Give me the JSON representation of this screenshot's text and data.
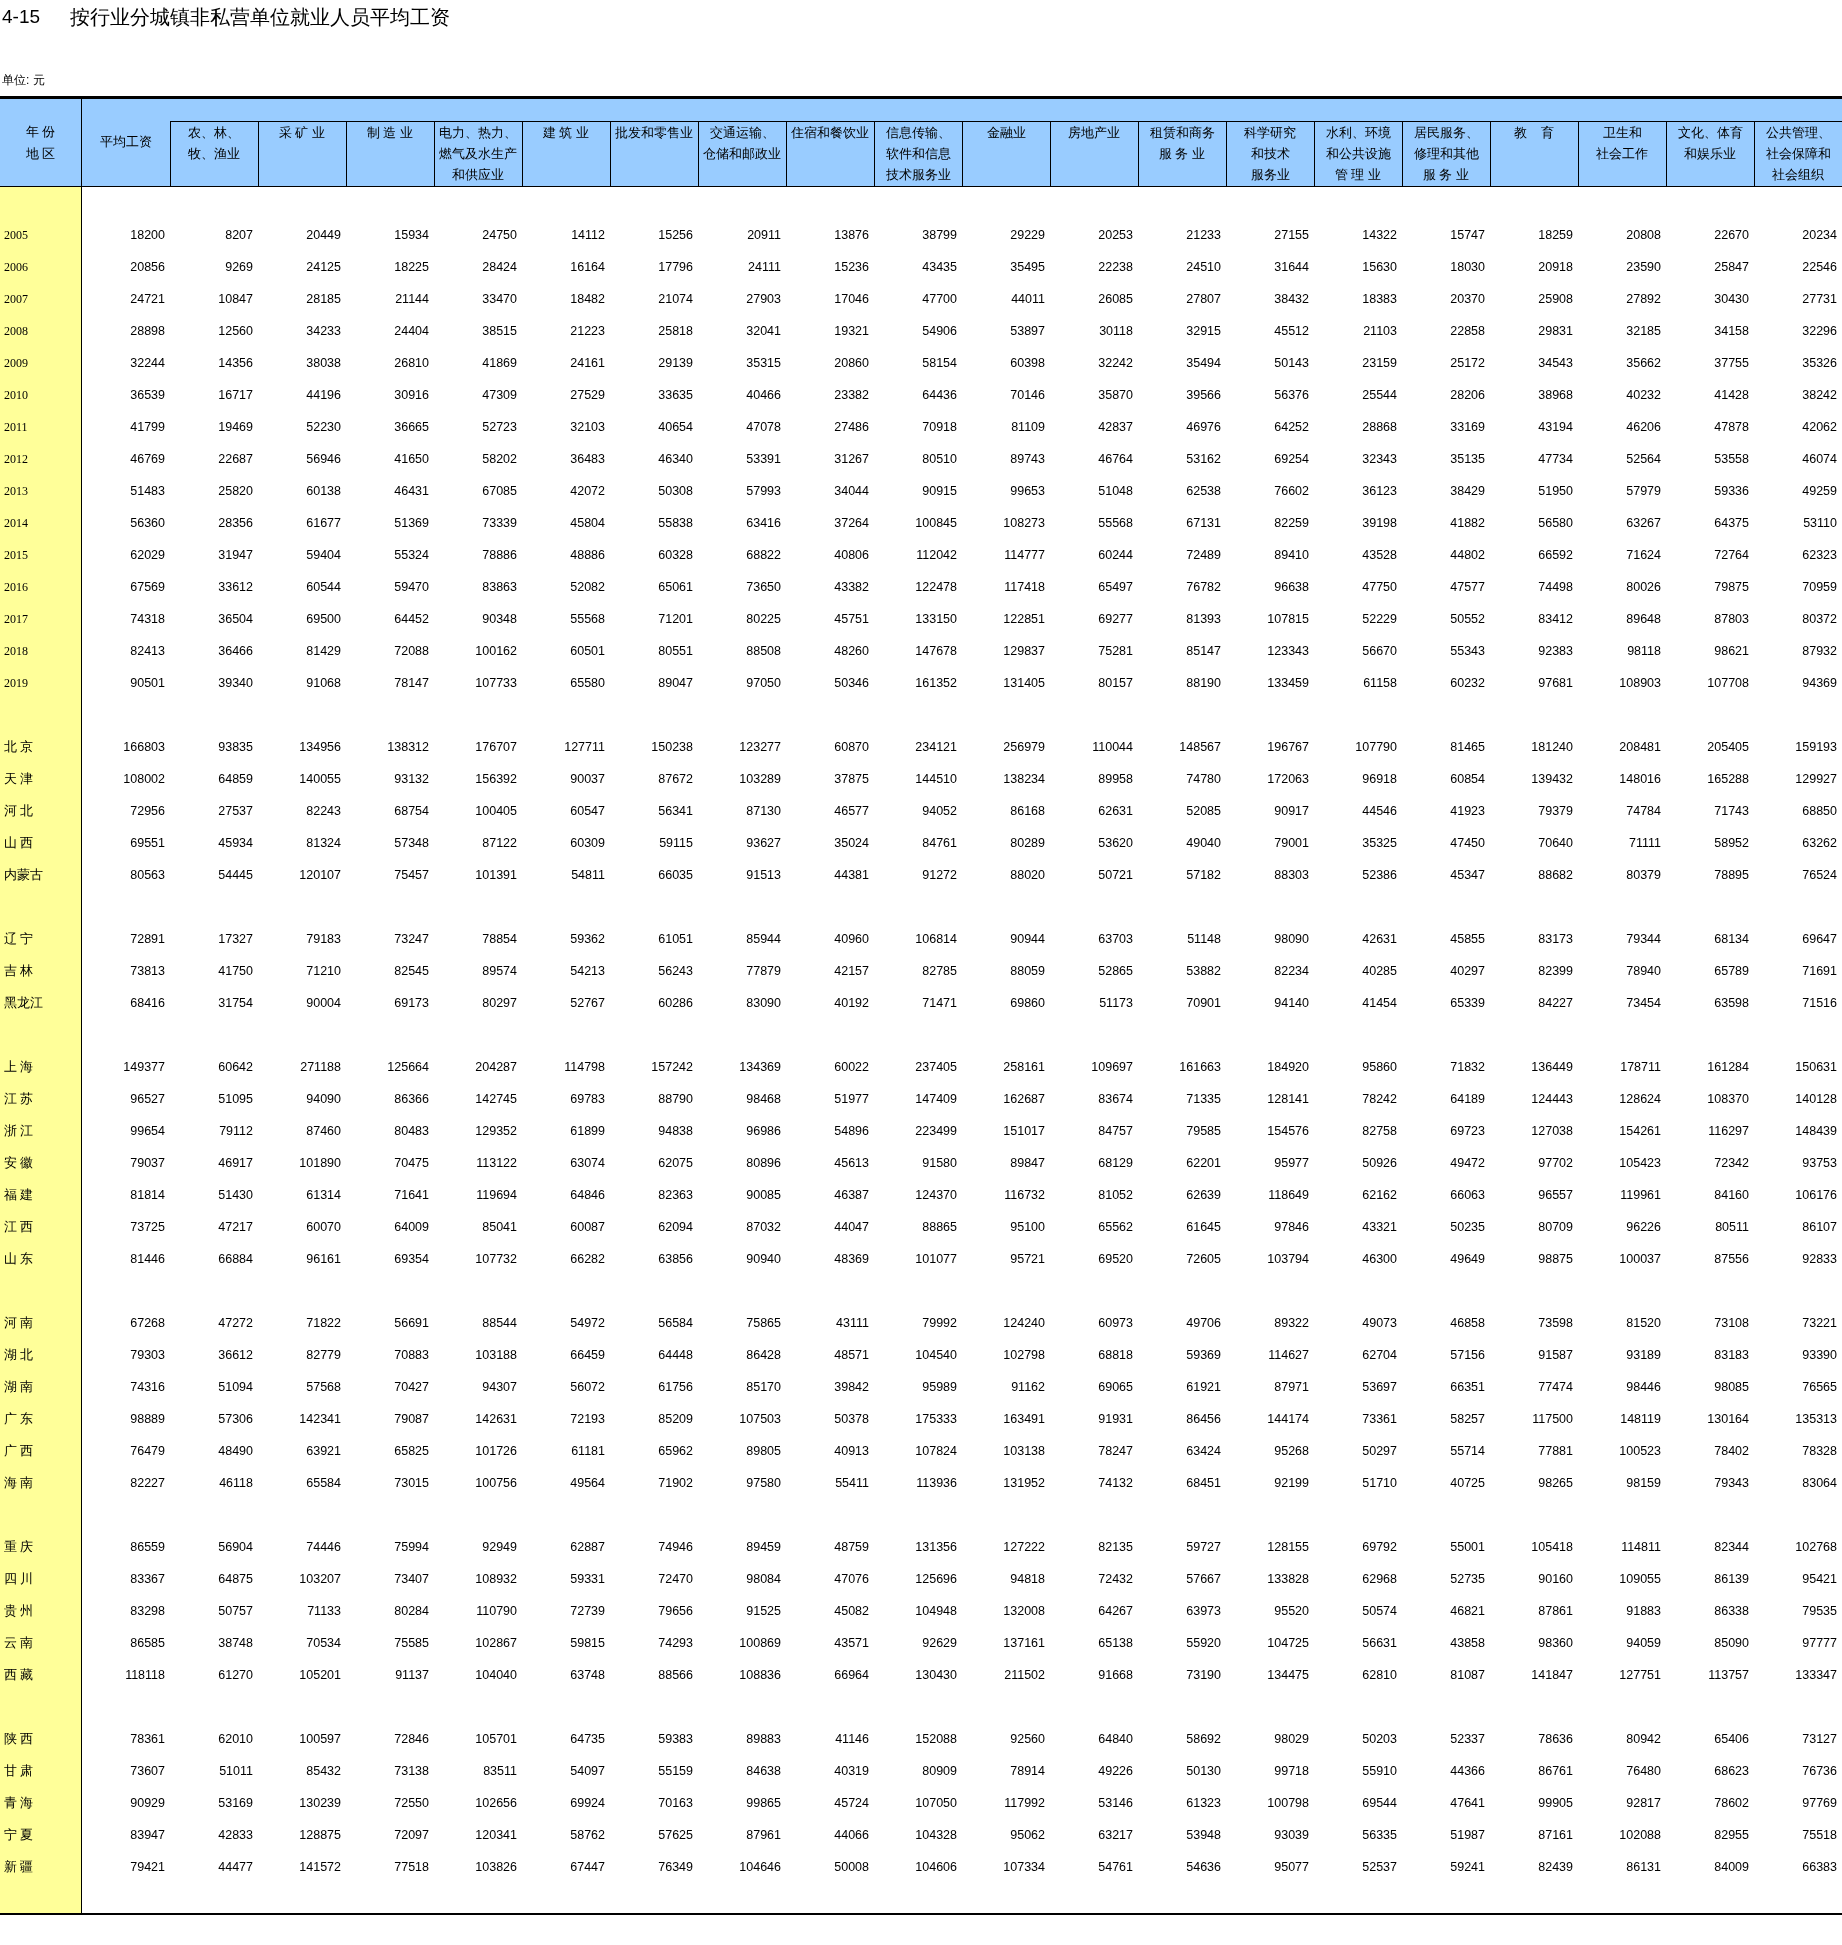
{
  "table_number": "4-15",
  "title": "按行业分城镇非私营单位就业人员平均工资",
  "unit": "单位: 元",
  "corner": [
    "年 份",
    "地 区"
  ],
  "columns": [
    [
      "平均工资"
    ],
    [
      "农、林、",
      "牧、渔业"
    ],
    [
      "采 矿 业"
    ],
    [
      "制 造 业"
    ],
    [
      "电力、热力、",
      "燃气及水生产",
      "和供应业"
    ],
    [
      "建 筑 业"
    ],
    [
      "批发和零售业"
    ],
    [
      "交通运输、",
      "仓储和邮政业"
    ],
    [
      "住宿和餐饮业"
    ],
    [
      "信息传输、",
      "软件和信息",
      "技术服务业"
    ],
    [
      "金融业"
    ],
    [
      "房地产业"
    ],
    [
      "租赁和商务",
      "服 务 业"
    ],
    [
      "科学研究",
      "和技术",
      "服务业"
    ],
    [
      "水利、环境",
      "和公共设施",
      "管 理 业"
    ],
    [
      "居民服务、",
      "修理和其他",
      "服 务 业"
    ],
    [
      "教    育"
    ],
    [
      "卫生和",
      "社会工作"
    ],
    [
      "文化、体育",
      "和娱乐业"
    ],
    [
      "公共管理、",
      "社会保障和",
      "社会组织"
    ]
  ],
  "sections": [
    {
      "kind": "year",
      "rows": [
        {
          "label": "2005",
          "values": [
            "18200",
            "8207",
            "20449",
            "15934",
            "24750",
            "14112",
            "15256",
            "20911",
            "13876",
            "38799",
            "29229",
            "20253",
            "21233",
            "27155",
            "14322",
            "15747",
            "18259",
            "20808",
            "22670",
            "20234"
          ]
        },
        {
          "label": "2006",
          "values": [
            "20856",
            "9269",
            "24125",
            "18225",
            "28424",
            "16164",
            "17796",
            "24111",
            "15236",
            "43435",
            "35495",
            "22238",
            "24510",
            "31644",
            "15630",
            "18030",
            "20918",
            "23590",
            "25847",
            "22546"
          ]
        },
        {
          "label": "2007",
          "values": [
            "24721",
            "10847",
            "28185",
            "21144",
            "33470",
            "18482",
            "21074",
            "27903",
            "17046",
            "47700",
            "44011",
            "26085",
            "27807",
            "38432",
            "18383",
            "20370",
            "25908",
            "27892",
            "30430",
            "27731"
          ]
        },
        {
          "label": "2008",
          "values": [
            "28898",
            "12560",
            "34233",
            "24404",
            "38515",
            "21223",
            "25818",
            "32041",
            "19321",
            "54906",
            "53897",
            "30118",
            "32915",
            "45512",
            "21103",
            "22858",
            "29831",
            "32185",
            "34158",
            "32296"
          ]
        },
        {
          "label": "2009",
          "values": [
            "32244",
            "14356",
            "38038",
            "26810",
            "41869",
            "24161",
            "29139",
            "35315",
            "20860",
            "58154",
            "60398",
            "32242",
            "35494",
            "50143",
            "23159",
            "25172",
            "34543",
            "35662",
            "37755",
            "35326"
          ]
        },
        {
          "label": "2010",
          "values": [
            "36539",
            "16717",
            "44196",
            "30916",
            "47309",
            "27529",
            "33635",
            "40466",
            "23382",
            "64436",
            "70146",
            "35870",
            "39566",
            "56376",
            "25544",
            "28206",
            "38968",
            "40232",
            "41428",
            "38242"
          ]
        },
        {
          "label": "2011",
          "values": [
            "41799",
            "19469",
            "52230",
            "36665",
            "52723",
            "32103",
            "40654",
            "47078",
            "27486",
            "70918",
            "81109",
            "42837",
            "46976",
            "64252",
            "28868",
            "33169",
            "43194",
            "46206",
            "47878",
            "42062"
          ]
        },
        {
          "label": "2012",
          "values": [
            "46769",
            "22687",
            "56946",
            "41650",
            "58202",
            "36483",
            "46340",
            "53391",
            "31267",
            "80510",
            "89743",
            "46764",
            "53162",
            "69254",
            "32343",
            "35135",
            "47734",
            "52564",
            "53558",
            "46074"
          ]
        },
        {
          "label": "2013",
          "values": [
            "51483",
            "25820",
            "60138",
            "46431",
            "67085",
            "42072",
            "50308",
            "57993",
            "34044",
            "90915",
            "99653",
            "51048",
            "62538",
            "76602",
            "36123",
            "38429",
            "51950",
            "57979",
            "59336",
            "49259"
          ]
        },
        {
          "label": "2014",
          "values": [
            "56360",
            "28356",
            "61677",
            "51369",
            "73339",
            "45804",
            "55838",
            "63416",
            "37264",
            "100845",
            "108273",
            "55568",
            "67131",
            "82259",
            "39198",
            "41882",
            "56580",
            "63267",
            "64375",
            "53110"
          ]
        },
        {
          "label": "2015",
          "values": [
            "62029",
            "31947",
            "59404",
            "55324",
            "78886",
            "48886",
            "60328",
            "68822",
            "40806",
            "112042",
            "114777",
            "60244",
            "72489",
            "89410",
            "43528",
            "44802",
            "66592",
            "71624",
            "72764",
            "62323"
          ]
        },
        {
          "label": "2016",
          "values": [
            "67569",
            "33612",
            "60544",
            "59470",
            "83863",
            "52082",
            "65061",
            "73650",
            "43382",
            "122478",
            "117418",
            "65497",
            "76782",
            "96638",
            "47750",
            "47577",
            "74498",
            "80026",
            "79875",
            "70959"
          ]
        },
        {
          "label": "2017",
          "values": [
            "74318",
            "36504",
            "69500",
            "64452",
            "90348",
            "55568",
            "71201",
            "80225",
            "45751",
            "133150",
            "122851",
            "69277",
            "81393",
            "107815",
            "52229",
            "50552",
            "83412",
            "89648",
            "87803",
            "80372"
          ]
        },
        {
          "label": "2018",
          "values": [
            "82413",
            "36466",
            "81429",
            "72088",
            "100162",
            "60501",
            "80551",
            "88508",
            "48260",
            "147678",
            "129837",
            "75281",
            "85147",
            "123343",
            "56670",
            "55343",
            "92383",
            "98118",
            "98621",
            "87932"
          ]
        },
        {
          "label": "2019",
          "values": [
            "90501",
            "39340",
            "91068",
            "78147",
            "107733",
            "65580",
            "89047",
            "97050",
            "50346",
            "161352",
            "131405",
            "80157",
            "88190",
            "133459",
            "61158",
            "60232",
            "97681",
            "108903",
            "107708",
            "94369"
          ]
        }
      ]
    },
    {
      "kind": "region",
      "rows": [
        {
          "label": "北 京",
          "values": [
            "166803",
            "93835",
            "134956",
            "138312",
            "176707",
            "127711",
            "150238",
            "123277",
            "60870",
            "234121",
            "256979",
            "110044",
            "148567",
            "196767",
            "107790",
            "81465",
            "181240",
            "208481",
            "205405",
            "159193"
          ]
        },
        {
          "label": "天 津",
          "values": [
            "108002",
            "64859",
            "140055",
            "93132",
            "156392",
            "90037",
            "87672",
            "103289",
            "37875",
            "144510",
            "138234",
            "89958",
            "74780",
            "172063",
            "96918",
            "60854",
            "139432",
            "148016",
            "165288",
            "129927"
          ]
        },
        {
          "label": "河 北",
          "values": [
            "72956",
            "27537",
            "82243",
            "68754",
            "100405",
            "60547",
            "56341",
            "87130",
            "46577",
            "94052",
            "86168",
            "62631",
            "52085",
            "90917",
            "44546",
            "41923",
            "79379",
            "74784",
            "71743",
            "68850"
          ]
        },
        {
          "label": "山 西",
          "values": [
            "69551",
            "45934",
            "81324",
            "57348",
            "87122",
            "60309",
            "59115",
            "93627",
            "35024",
            "84761",
            "80289",
            "53620",
            "49040",
            "79001",
            "35325",
            "47450",
            "70640",
            "71111",
            "58952",
            "63262"
          ]
        },
        {
          "label": "内蒙古",
          "values": [
            "80563",
            "54445",
            "120107",
            "75457",
            "101391",
            "54811",
            "66035",
            "91513",
            "44381",
            "91272",
            "88020",
            "50721",
            "57182",
            "88303",
            "52386",
            "45347",
            "88682",
            "80379",
            "78895",
            "76524"
          ]
        }
      ]
    },
    {
      "kind": "region",
      "rows": [
        {
          "label": "辽 宁",
          "values": [
            "72891",
            "17327",
            "79183",
            "73247",
            "78854",
            "59362",
            "61051",
            "85944",
            "40960",
            "106814",
            "90944",
            "63703",
            "51148",
            "98090",
            "42631",
            "45855",
            "83173",
            "79344",
            "68134",
            "69647"
          ]
        },
        {
          "label": "吉 林",
          "values": [
            "73813",
            "41750",
            "71210",
            "82545",
            "89574",
            "54213",
            "56243",
            "77879",
            "42157",
            "82785",
            "88059",
            "52865",
            "53882",
            "82234",
            "40285",
            "40297",
            "82399",
            "78940",
            "65789",
            "71691"
          ]
        },
        {
          "label": "黑龙江",
          "values": [
            "68416",
            "31754",
            "90004",
            "69173",
            "80297",
            "52767",
            "60286",
            "83090",
            "40192",
            "71471",
            "69860",
            "51173",
            "70901",
            "94140",
            "41454",
            "65339",
            "84227",
            "73454",
            "63598",
            "71516"
          ]
        }
      ]
    },
    {
      "kind": "region",
      "rows": [
        {
          "label": "上 海",
          "values": [
            "149377",
            "60642",
            "271188",
            "125664",
            "204287",
            "114798",
            "157242",
            "134369",
            "60022",
            "237405",
            "258161",
            "109697",
            "161663",
            "184920",
            "95860",
            "71832",
            "136449",
            "178711",
            "161284",
            "150631"
          ]
        },
        {
          "label": "江 苏",
          "values": [
            "96527",
            "51095",
            "94090",
            "86366",
            "142745",
            "69783",
            "88790",
            "98468",
            "51977",
            "147409",
            "162687",
            "83674",
            "71335",
            "128141",
            "78242",
            "64189",
            "124443",
            "128624",
            "108370",
            "140128"
          ]
        },
        {
          "label": "浙 江",
          "values": [
            "99654",
            "79112",
            "87460",
            "80483",
            "129352",
            "61899",
            "94838",
            "96986",
            "54896",
            "223499",
            "151017",
            "84757",
            "79585",
            "154576",
            "82758",
            "69723",
            "127038",
            "154261",
            "116297",
            "148439"
          ]
        },
        {
          "label": "安 徽",
          "values": [
            "79037",
            "46917",
            "101890",
            "70475",
            "113122",
            "63074",
            "62075",
            "80896",
            "45613",
            "91580",
            "89847",
            "68129",
            "62201",
            "95977",
            "50926",
            "49472",
            "97702",
            "105423",
            "72342",
            "93753"
          ]
        },
        {
          "label": "福 建",
          "values": [
            "81814",
            "51430",
            "61314",
            "71641",
            "119694",
            "64846",
            "82363",
            "90085",
            "46387",
            "124370",
            "116732",
            "81052",
            "62639",
            "118649",
            "62162",
            "66063",
            "96557",
            "119961",
            "84160",
            "106176"
          ]
        },
        {
          "label": "江 西",
          "values": [
            "73725",
            "47217",
            "60070",
            "64009",
            "85041",
            "60087",
            "62094",
            "87032",
            "44047",
            "88865",
            "95100",
            "65562",
            "61645",
            "97846",
            "43321",
            "50235",
            "80709",
            "96226",
            "80511",
            "86107"
          ]
        },
        {
          "label": "山 东",
          "values": [
            "81446",
            "66884",
            "96161",
            "69354",
            "107732",
            "66282",
            "63856",
            "90940",
            "48369",
            "101077",
            "95721",
            "69520",
            "72605",
            "103794",
            "46300",
            "49649",
            "98875",
            "100037",
            "87556",
            "92833"
          ]
        }
      ]
    },
    {
      "kind": "region",
      "rows": [
        {
          "label": "河 南",
          "values": [
            "67268",
            "47272",
            "71822",
            "56691",
            "88544",
            "54972",
            "56584",
            "75865",
            "43111",
            "79992",
            "124240",
            "60973",
            "49706",
            "89322",
            "49073",
            "46858",
            "73598",
            "81520",
            "73108",
            "73221"
          ]
        },
        {
          "label": "湖 北",
          "values": [
            "79303",
            "36612",
            "82779",
            "70883",
            "103188",
            "66459",
            "64448",
            "86428",
            "48571",
            "104540",
            "102798",
            "68818",
            "59369",
            "114627",
            "62704",
            "57156",
            "91587",
            "93189",
            "83183",
            "93390"
          ]
        },
        {
          "label": "湖 南",
          "values": [
            "74316",
            "51094",
            "57568",
            "70427",
            "94307",
            "56072",
            "61756",
            "85170",
            "39842",
            "95989",
            "91162",
            "69065",
            "61921",
            "87971",
            "53697",
            "66351",
            "77474",
            "98446",
            "98085",
            "76565"
          ]
        },
        {
          "label": "广 东",
          "values": [
            "98889",
            "57306",
            "142341",
            "79087",
            "142631",
            "72193",
            "85209",
            "107503",
            "50378",
            "175333",
            "163491",
            "91931",
            "86456",
            "144174",
            "73361",
            "58257",
            "117500",
            "148119",
            "130164",
            "135313"
          ]
        },
        {
          "label": "广 西",
          "values": [
            "76479",
            "48490",
            "63921",
            "65825",
            "101726",
            "61181",
            "65962",
            "89805",
            "40913",
            "107824",
            "103138",
            "78247",
            "63424",
            "95268",
            "50297",
            "55714",
            "77881",
            "100523",
            "78402",
            "78328"
          ]
        },
        {
          "label": "海 南",
          "values": [
            "82227",
            "46118",
            "65584",
            "73015",
            "100756",
            "49564",
            "71902",
            "97580",
            "55411",
            "113936",
            "131952",
            "74132",
            "68451",
            "92199",
            "51710",
            "40725",
            "98265",
            "98159",
            "79343",
            "83064"
          ]
        }
      ]
    },
    {
      "kind": "region",
      "rows": [
        {
          "label": "重 庆",
          "values": [
            "86559",
            "56904",
            "74446",
            "75994",
            "92949",
            "62887",
            "74946",
            "89459",
            "48759",
            "131356",
            "127222",
            "82135",
            "59727",
            "128155",
            "69792",
            "55001",
            "105418",
            "114811",
            "82344",
            "102768"
          ]
        },
        {
          "label": "四 川",
          "values": [
            "83367",
            "64875",
            "103207",
            "73407",
            "108932",
            "59331",
            "72470",
            "98084",
            "47076",
            "125696",
            "94818",
            "72432",
            "57667",
            "133828",
            "62968",
            "52735",
            "90160",
            "109055",
            "86139",
            "95421"
          ]
        },
        {
          "label": "贵 州",
          "values": [
            "83298",
            "50757",
            "71133",
            "80284",
            "110790",
            "72739",
            "79656",
            "91525",
            "45082",
            "104948",
            "132008",
            "64267",
            "63973",
            "95520",
            "50574",
            "46821",
            "87861",
            "91883",
            "86338",
            "79535"
          ]
        },
        {
          "label": "云 南",
          "values": [
            "86585",
            "38748",
            "70534",
            "75585",
            "102867",
            "59815",
            "74293",
            "100869",
            "43571",
            "92629",
            "137161",
            "65138",
            "55920",
            "104725",
            "56631",
            "43858",
            "98360",
            "94059",
            "85090",
            "97777"
          ]
        },
        {
          "label": "西 藏",
          "values": [
            "118118",
            "61270",
            "105201",
            "91137",
            "104040",
            "63748",
            "88566",
            "108836",
            "66964",
            "130430",
            "211502",
            "91668",
            "73190",
            "134475",
            "62810",
            "81087",
            "141847",
            "127751",
            "113757",
            "133347"
          ]
        }
      ]
    },
    {
      "kind": "region",
      "rows": [
        {
          "label": "陕 西",
          "values": [
            "78361",
            "62010",
            "100597",
            "72846",
            "105701",
            "64735",
            "59383",
            "89883",
            "41146",
            "152088",
            "92560",
            "64840",
            "58692",
            "98029",
            "50203",
            "52337",
            "78636",
            "80942",
            "65406",
            "73127"
          ]
        },
        {
          "label": "甘 肃",
          "values": [
            "73607",
            "51011",
            "85432",
            "73138",
            "83511",
            "54097",
            "55159",
            "84638",
            "40319",
            "80909",
            "78914",
            "49226",
            "50130",
            "99718",
            "55910",
            "44366",
            "86761",
            "76480",
            "68623",
            "76736"
          ]
        },
        {
          "label": "青 海",
          "values": [
            "90929",
            "53169",
            "130239",
            "72550",
            "102656",
            "69924",
            "70163",
            "99865",
            "45724",
            "107050",
            "117992",
            "53146",
            "61323",
            "100798",
            "69544",
            "47641",
            "99905",
            "92817",
            "78602",
            "97769"
          ]
        },
        {
          "label": "宁 夏",
          "values": [
            "83947",
            "42833",
            "128875",
            "72097",
            "120341",
            "58762",
            "57625",
            "87961",
            "44066",
            "104328",
            "95062",
            "63217",
            "53948",
            "93039",
            "56335",
            "51987",
            "87161",
            "102088",
            "82955",
            "75518"
          ]
        },
        {
          "label": "新 疆",
          "values": [
            "79421",
            "44477",
            "141572",
            "77518",
            "103826",
            "67447",
            "76349",
            "104646",
            "50008",
            "104606",
            "107334",
            "54761",
            "54636",
            "95077",
            "52537",
            "59241",
            "82439",
            "86131",
            "84009",
            "66383"
          ]
        }
      ]
    }
  ]
}
